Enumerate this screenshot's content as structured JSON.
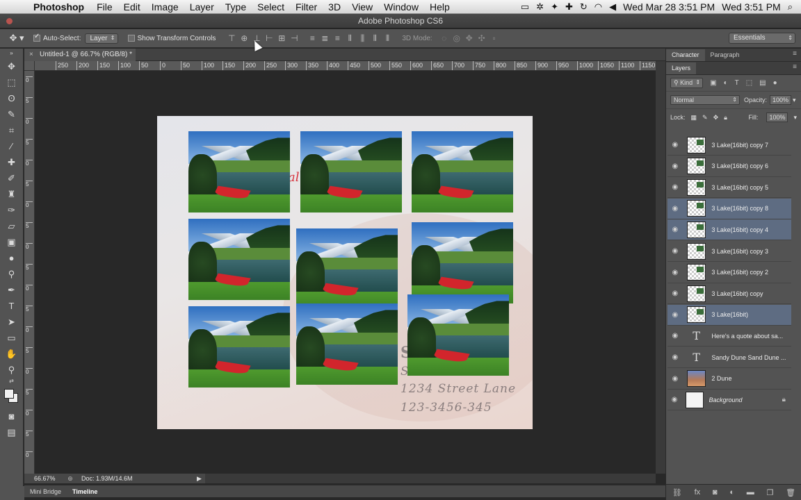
{
  "menubar": {
    "app_name": "Photoshop",
    "menus": [
      "File",
      "Edit",
      "Image",
      "Layer",
      "Type",
      "Select",
      "Filter",
      "3D",
      "View",
      "Window",
      "Help"
    ],
    "clock": "Wed Mar 28  3:51 PM",
    "clock2": "Wed 3:51 PM"
  },
  "window": {
    "title": "Adobe Photoshop CS6"
  },
  "options": {
    "auto_select_label": "Auto-Select:",
    "auto_select_value": "Layer",
    "transform_label": "Show Transform Controls",
    "mode3d_label": "3D Mode:",
    "workspace": "Essentials"
  },
  "document": {
    "tab_title": "Untitled-1 @ 66.7% (RGB/8) *",
    "ruler_h": [
      "250",
      "200",
      "150",
      "100",
      "50",
      "0",
      "50",
      "100",
      "150",
      "200",
      "250",
      "300",
      "350",
      "400",
      "450",
      "500",
      "550",
      "600",
      "650",
      "700",
      "750",
      "800",
      "850",
      "900",
      "950",
      "1000",
      "1050",
      "1100",
      "1150"
    ],
    "ruler_v": [
      "0",
      "5",
      "0",
      "5",
      "0",
      "5",
      "0",
      "5",
      "0",
      "5",
      "0",
      "5",
      "0",
      "5",
      "0",
      "5",
      "0",
      "5",
      "0"
    ],
    "canvas_text": {
      "red_fragment": "al",
      "title_fragment": "S       E",
      "sub_fragment": "S",
      "address": "1234 Street Lane",
      "phone": "123-3456-345"
    }
  },
  "panels": {
    "top_tabs": [
      "Character",
      "Paragraph"
    ],
    "layers_tab": "Layers",
    "kind_label": "Kind",
    "blend_mode": "Normal",
    "opacity_label": "Opacity:",
    "opacity_value": "100%",
    "lock_label": "Lock:",
    "fill_label": "Fill:",
    "fill_value": "100%",
    "layers": [
      {
        "name": "3 Lake(16bit) copy 7",
        "type": "image",
        "selected": false
      },
      {
        "name": "3 Lake(16bit) copy 6",
        "type": "image",
        "selected": false
      },
      {
        "name": "3 Lake(16bit) copy 5",
        "type": "image",
        "selected": false
      },
      {
        "name": "3 Lake(16bit) copy 8",
        "type": "image",
        "selected": true
      },
      {
        "name": "3 Lake(16bit) copy 4",
        "type": "image",
        "selected": true
      },
      {
        "name": "3 Lake(16bit) copy 3",
        "type": "image",
        "selected": false
      },
      {
        "name": "3 Lake(16bit) copy 2",
        "type": "image",
        "selected": false
      },
      {
        "name": "3 Lake(16bit) copy",
        "type": "image",
        "selected": false
      },
      {
        "name": "3 Lake(16bit)",
        "type": "image",
        "selected": true
      },
      {
        "name": "Here's a quote about sa...",
        "type": "text",
        "selected": false
      },
      {
        "name": "Sandy Dune Sand Dune ...",
        "type": "text",
        "selected": false
      },
      {
        "name": "2 Dune",
        "type": "dune",
        "selected": false
      },
      {
        "name": "Background",
        "type": "background",
        "selected": false
      }
    ]
  },
  "status": {
    "zoom": "66.67%",
    "doc": "Doc: 1.93M/14.6M"
  },
  "bottom_tabs": [
    "Mini Bridge",
    "Timeline"
  ]
}
